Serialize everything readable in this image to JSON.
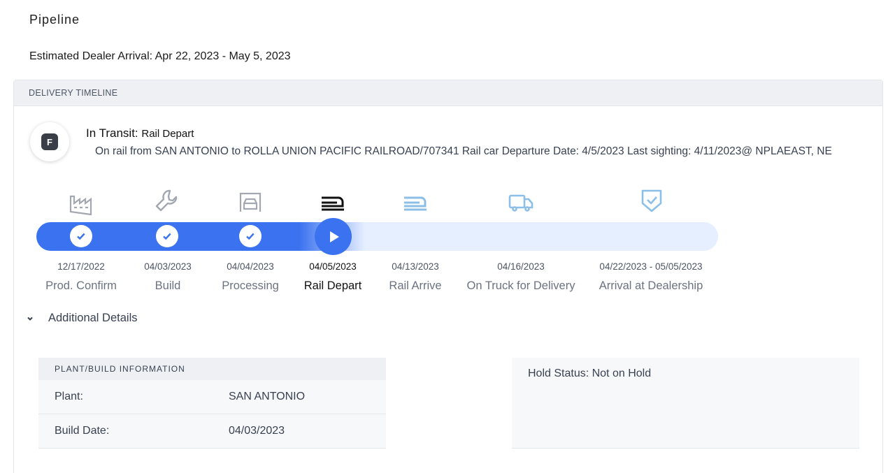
{
  "page": {
    "title": "Pipeline",
    "eta": "Estimated Dealer Arrival: Apr 22, 2023 - May 5, 2023"
  },
  "timeline": {
    "header": "DELIVERY TIMELINE",
    "avatar_letter": "F",
    "status_label": "In Transit:",
    "status_value": "Rail Depart",
    "status_description": "On rail from SAN ANTONIO to ROLLA UNION PACIFIC RAILROAD/707341 Rail car Departure Date: 4/5/2023 Last sighting: 4/11/2023@ NPLAEAST, NE",
    "steps": [
      {
        "date": "12/17/2022",
        "label": "Prod. Confirm",
        "icon": "factory-icon",
        "state": "complete"
      },
      {
        "date": "04/03/2023",
        "label": "Build",
        "icon": "wrench-icon",
        "state": "complete"
      },
      {
        "date": "04/04/2023",
        "label": "Processing",
        "icon": "car-wash-icon",
        "state": "complete"
      },
      {
        "date": "04/05/2023",
        "label": "Rail Depart",
        "icon": "train-icon",
        "state": "current"
      },
      {
        "date": "04/13/2023",
        "label": "Rail Arrive",
        "icon": "train-icon",
        "state": "upcoming"
      },
      {
        "date": "04/16/2023",
        "label": "On Truck for Delivery",
        "icon": "truck-icon",
        "state": "upcoming"
      },
      {
        "date": "04/22/2023 - 05/05/2023",
        "label": "Arrival at Dealership",
        "icon": "shield-check-icon",
        "state": "upcoming"
      }
    ],
    "colors": {
      "accent": "#3b72f0",
      "track_bg": "#e6efff",
      "upcoming_icon": "#8cbfe8",
      "complete_icon": "#9ca3af"
    }
  },
  "details": {
    "toggle_label": "Additional Details",
    "plant": {
      "header": "PLANT/BUILD INFORMATION",
      "rows": [
        {
          "key": "Plant:",
          "value": "SAN ANTONIO"
        },
        {
          "key": "Build Date:",
          "value": "04/03/2023"
        }
      ]
    },
    "hold_status": "Hold Status: Not on Hold"
  }
}
